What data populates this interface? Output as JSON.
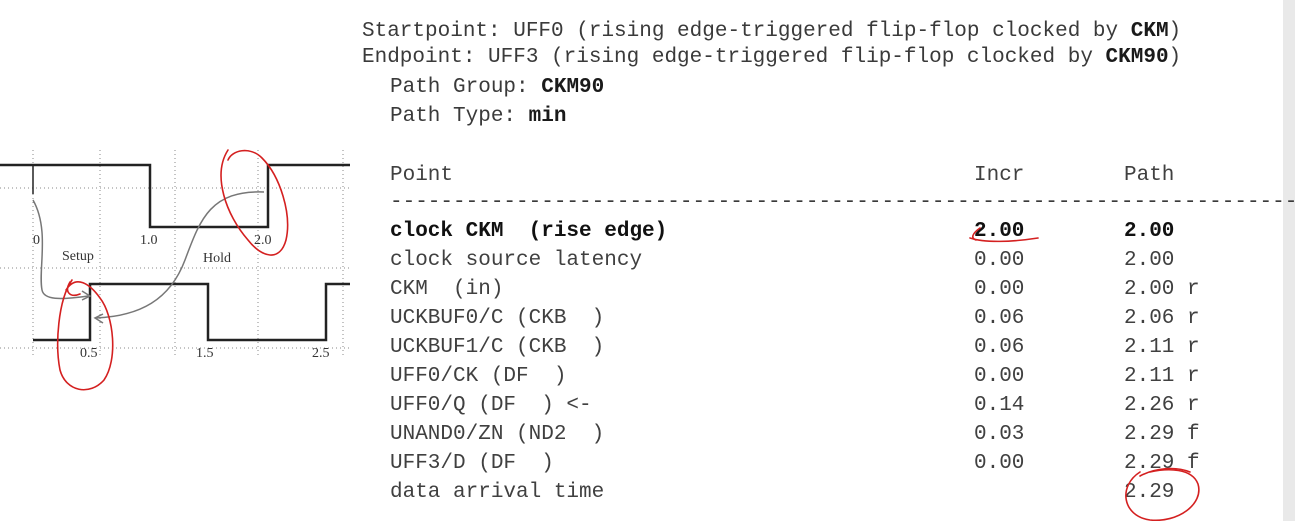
{
  "header": {
    "startpoint_label": "Startpoint:",
    "startpoint_text": " UFF0 (rising edge-triggered flip-flop clocked by ",
    "startpoint_clock": "CKM",
    "startpoint_close": ")",
    "endpoint_label": "Endpoint:",
    "endpoint_text": " UFF3 (rising edge-triggered flip-flop clocked by ",
    "endpoint_clock": "CKM90",
    "endpoint_close": ")",
    "path_group_label": "Path Group: ",
    "path_group_value": "CKM90",
    "path_type_label": "Path Type: ",
    "path_type_value": "min"
  },
  "table": {
    "columns": [
      "Point",
      "Incr",
      "Path"
    ],
    "separator": "--------------------------------------------------------------------------------------------",
    "rows": [
      {
        "point": "clock CKM  (rise edge)",
        "incr": "2.00",
        "path": "2.00",
        "bold": true
      },
      {
        "point": "clock source latency",
        "incr": "0.00",
        "path": "2.00"
      },
      {
        "point": "CKM  (in)",
        "incr": "0.00",
        "path": "2.00 r"
      },
      {
        "point": "UCKBUF0/C (CKB  )",
        "incr": "0.06",
        "path": "2.06 r"
      },
      {
        "point": "UCKBUF1/C (CKB  )",
        "incr": "0.06",
        "path": "2.11 r"
      },
      {
        "point": "UFF0/CK (DF  )",
        "incr": "0.00",
        "path": "2.11 r"
      },
      {
        "point": "UFF0/Q (DF  ) <-",
        "incr": "0.14",
        "path": "2.26 r"
      },
      {
        "point": "UNAND0/ZN (ND2  )",
        "incr": "0.03",
        "path": "2.29 f"
      },
      {
        "point": "UFF3/D (DF  )",
        "incr": "0.00",
        "path": "2.29 f"
      },
      {
        "point": "data arrival time",
        "incr": "",
        "path": "2.29"
      }
    ]
  },
  "diagram": {
    "top_ticks": [
      "0",
      "1.0",
      "2.0"
    ],
    "bottom_ticks": [
      "0.5",
      "1.5",
      "2.5"
    ],
    "setup_label": "Setup",
    "hold_label": "Hold"
  },
  "colors": {
    "annotation": "#d42020",
    "text": "#333333",
    "grid": "#888888"
  }
}
